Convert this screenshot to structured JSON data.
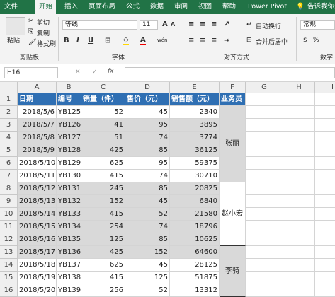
{
  "tabs": [
    "文件",
    "开始",
    "插入",
    "页面布局",
    "公式",
    "数据",
    "审阅",
    "视图",
    "帮助",
    "Power Pivot"
  ],
  "tell_me": "告诉我你想",
  "clipboard": {
    "paste": "粘贴",
    "cut": "剪切",
    "copy": "复制",
    "format_painter": "格式刷",
    "label": "剪贴板"
  },
  "font": {
    "font_name": "等线",
    "font_size": "11",
    "label": "字体",
    "bold": "B",
    "italic": "I",
    "underline": "U",
    "wen": "wén"
  },
  "alignment": {
    "wrap": "自动换行",
    "merge": "合并后居中",
    "label": "对齐方式"
  },
  "number": {
    "format": "常规",
    "label": "数字"
  },
  "formula_bar": {
    "name_box": "H16",
    "fx": "fx",
    "value": ""
  },
  "colors": {
    "accent": "#217346",
    "header_fill": "#2f6fb3",
    "shade_fill": "#d9d9d9"
  },
  "column_letters": [
    "A",
    "B",
    "C",
    "D",
    "E",
    "F",
    "G",
    "H",
    "I"
  ],
  "table": {
    "headers": [
      "日期",
      "编号",
      "销量（件）",
      "售价（元）",
      "销售额（元）",
      "业务员"
    ],
    "rows": [
      [
        "2018/5/6",
        "YB125",
        "52",
        "45",
        "2340"
      ],
      [
        "2018/5/7",
        "YB126",
        "41",
        "95",
        "3895"
      ],
      [
        "2018/5/8",
        "YB127",
        "51",
        "74",
        "3774"
      ],
      [
        "2018/5/9",
        "YB128",
        "425",
        "85",
        "36125"
      ],
      [
        "2018/5/10",
        "YB129",
        "625",
        "95",
        "59375"
      ],
      [
        "2018/5/11",
        "YB130",
        "415",
        "74",
        "30710"
      ],
      [
        "2018/5/12",
        "YB131",
        "245",
        "85",
        "20825"
      ],
      [
        "2018/5/13",
        "YB132",
        "152",
        "45",
        "6840"
      ],
      [
        "2018/5/14",
        "YB133",
        "415",
        "52",
        "21580"
      ],
      [
        "2018/5/15",
        "YB134",
        "254",
        "74",
        "18796"
      ],
      [
        "2018/5/16",
        "YB135",
        "125",
        "85",
        "10625"
      ],
      [
        "2018/5/17",
        "YB136",
        "425",
        "152",
        "64600"
      ],
      [
        "2018/5/18",
        "YB137",
        "625",
        "45",
        "28125"
      ],
      [
        "2018/5/19",
        "YB138",
        "415",
        "125",
        "51875"
      ],
      [
        "2018/5/20",
        "YB139",
        "256",
        "52",
        "13312"
      ]
    ],
    "salespersons": [
      "张丽",
      "赵小宏",
      "李骑"
    ]
  }
}
